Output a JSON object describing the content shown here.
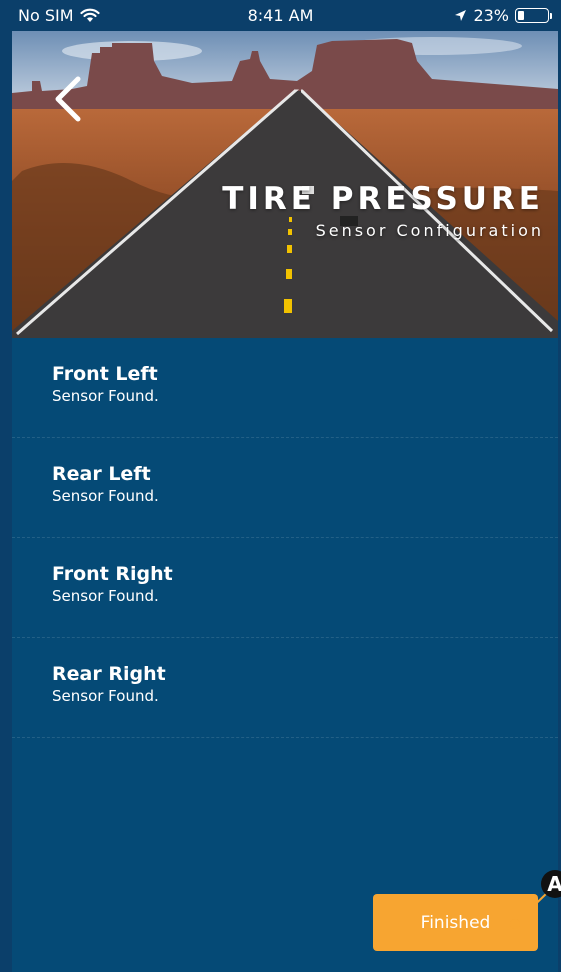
{
  "status_bar": {
    "carrier": "No SIM",
    "time": "8:41 AM",
    "battery_percent": "23%",
    "battery_level": 0.23,
    "icons": [
      "wifi-icon",
      "location-arrow-icon",
      "battery-icon"
    ]
  },
  "header": {
    "title": "TIRE PRESSURE",
    "subtitle": "Sensor Configuration",
    "back_icon": "chevron-left-icon"
  },
  "sensors": [
    {
      "name": "Front Left",
      "status": "Sensor Found."
    },
    {
      "name": "Rear Left",
      "status": "Sensor Found."
    },
    {
      "name": "Front Right",
      "status": "Sensor Found."
    },
    {
      "name": "Rear Right",
      "status": "Sensor Found."
    }
  ],
  "footer": {
    "finish_label": "Finished",
    "annotation_label": "A"
  },
  "colors": {
    "background": "#054a76",
    "accent": "#f7a531",
    "text": "#ffffff"
  }
}
